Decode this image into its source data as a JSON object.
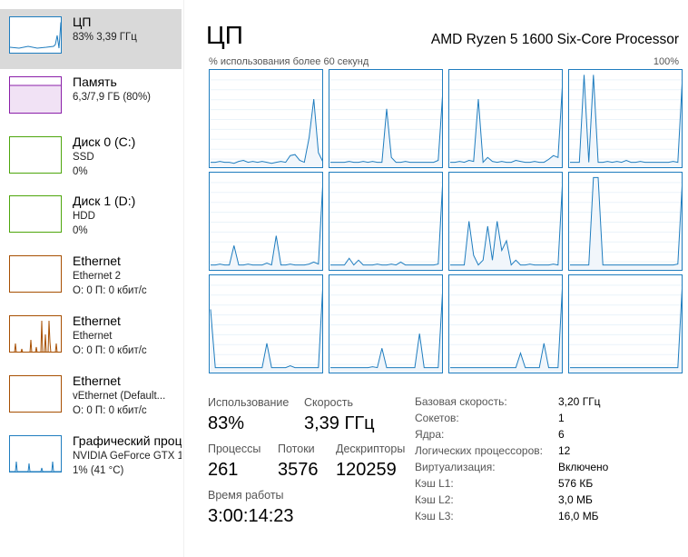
{
  "sidebar": {
    "items": [
      {
        "title": "ЦП",
        "line1": "83% 3,39 ГГц",
        "line2": "",
        "color": "#1f7dbf",
        "selected": true
      },
      {
        "title": "Память",
        "line1": "6,3/7,9 ГБ (80%)",
        "line2": "",
        "color": "#8b1fa9"
      },
      {
        "title": "Диск 0 (C:)",
        "line1": "SSD",
        "line2": "0%",
        "color": "#4da60c"
      },
      {
        "title": "Диск 1 (D:)",
        "line1": "HDD",
        "line2": "0%",
        "color": "#4da60c"
      },
      {
        "title": "Ethernet",
        "line1": "Ethernet 2",
        "line2": "О: 0 П: 0 кбит/с",
        "color": "#a74f01"
      },
      {
        "title": "Ethernet",
        "line1": "Ethernet",
        "line2": "О: 0 П: 0 кбит/с",
        "color": "#a74f01"
      },
      {
        "title": "Ethernet",
        "line1": "vEthernet (Default...",
        "line2": "О: 0 П: 0 кбит/с",
        "color": "#a74f01"
      },
      {
        "title": "Графический процессор",
        "line1": "NVIDIA GeForce GTX 1050",
        "line2": "1% (41 °C)",
        "color": "#1f7dbf"
      }
    ]
  },
  "header": {
    "title": "ЦП",
    "cpu_model": "AMD Ryzen 5 1600 Six-Core Processor",
    "axis_label": "% использования более 60 секунд",
    "axis_max": "100%"
  },
  "graph_color": "#1f7dbf",
  "cores": [
    [
      95,
      95,
      94,
      95,
      95,
      96,
      94,
      93,
      95,
      94,
      95,
      94,
      95,
      96,
      95,
      94,
      95,
      88,
      87,
      93,
      95,
      70,
      30,
      85,
      95
    ],
    [
      95,
      95,
      95,
      95,
      94,
      95,
      95,
      94,
      95,
      94,
      95,
      95,
      40,
      90,
      95,
      95,
      94,
      95,
      95,
      95,
      95,
      95,
      95,
      93,
      20
    ],
    [
      95,
      95,
      94,
      95,
      93,
      94,
      30,
      95,
      90,
      94,
      95,
      94,
      95,
      95,
      93,
      94,
      95,
      95,
      94,
      95,
      95,
      92,
      88,
      90,
      10
    ],
    [
      95,
      95,
      95,
      5,
      95,
      5,
      95,
      95,
      94,
      95,
      94,
      95,
      93,
      95,
      95,
      94,
      95,
      95,
      95,
      95,
      95,
      95,
      94,
      95,
      5
    ],
    [
      95,
      95,
      94,
      95,
      95,
      75,
      95,
      95,
      94,
      95,
      95,
      95,
      93,
      95,
      65,
      95,
      95,
      94,
      95,
      95,
      95,
      94,
      92,
      94,
      5
    ],
    [
      95,
      95,
      95,
      95,
      88,
      95,
      90,
      95,
      95,
      95,
      94,
      95,
      95,
      94,
      95,
      92,
      95,
      95,
      95,
      95,
      95,
      95,
      95,
      94,
      5
    ],
    [
      95,
      95,
      95,
      95,
      50,
      85,
      95,
      90,
      55,
      90,
      50,
      80,
      70,
      95,
      90,
      95,
      95,
      94,
      95,
      95,
      95,
      95,
      94,
      95,
      5
    ],
    [
      95,
      95,
      95,
      95,
      95,
      5,
      5,
      95,
      95,
      95,
      95,
      95,
      95,
      95,
      95,
      95,
      95,
      95,
      95,
      95,
      95,
      95,
      95,
      94,
      5
    ],
    [
      35,
      95,
      95,
      95,
      95,
      95,
      95,
      95,
      95,
      95,
      95,
      95,
      70,
      95,
      95,
      95,
      95,
      93,
      95,
      95,
      95,
      95,
      95,
      95,
      5
    ],
    [
      95,
      95,
      95,
      95,
      95,
      95,
      95,
      95,
      95,
      94,
      95,
      75,
      95,
      95,
      95,
      95,
      95,
      95,
      95,
      60,
      95,
      95,
      95,
      95,
      10
    ],
    [
      95,
      95,
      95,
      95,
      95,
      95,
      95,
      95,
      95,
      95,
      95,
      95,
      95,
      95,
      95,
      80,
      95,
      95,
      95,
      95,
      70,
      95,
      95,
      95,
      5
    ],
    [
      95,
      95,
      95,
      95,
      95,
      95,
      95,
      95,
      95,
      95,
      95,
      95,
      95,
      95,
      95,
      95,
      95,
      95,
      95,
      95,
      95,
      95,
      95,
      95,
      5
    ]
  ],
  "stats": {
    "usage_label": "Использование",
    "usage_value": "83%",
    "speed_label": "Скорость",
    "speed_value": "3,39 ГГц",
    "processes_label": "Процессы",
    "processes_value": "261",
    "threads_label": "Потоки",
    "threads_value": "3576",
    "handles_label": "Дескрипторы",
    "handles_value": "120259",
    "uptime_label": "Время работы",
    "uptime_value": "3:00:14:23"
  },
  "details": [
    {
      "label": "Базовая скорость:",
      "value": "3,20 ГГц"
    },
    {
      "label": "Сокетов:",
      "value": "1"
    },
    {
      "label": "Ядра:",
      "value": "6"
    },
    {
      "label": "Логических процессоров:",
      "value": "12"
    },
    {
      "label": "Виртуализация:",
      "value": "Включено"
    },
    {
      "label": "Кэш L1:",
      "value": "576 КБ"
    },
    {
      "label": "Кэш L2:",
      "value": "3,0 МБ"
    },
    {
      "label": "Кэш L3:",
      "value": "16,0 МБ"
    }
  ]
}
